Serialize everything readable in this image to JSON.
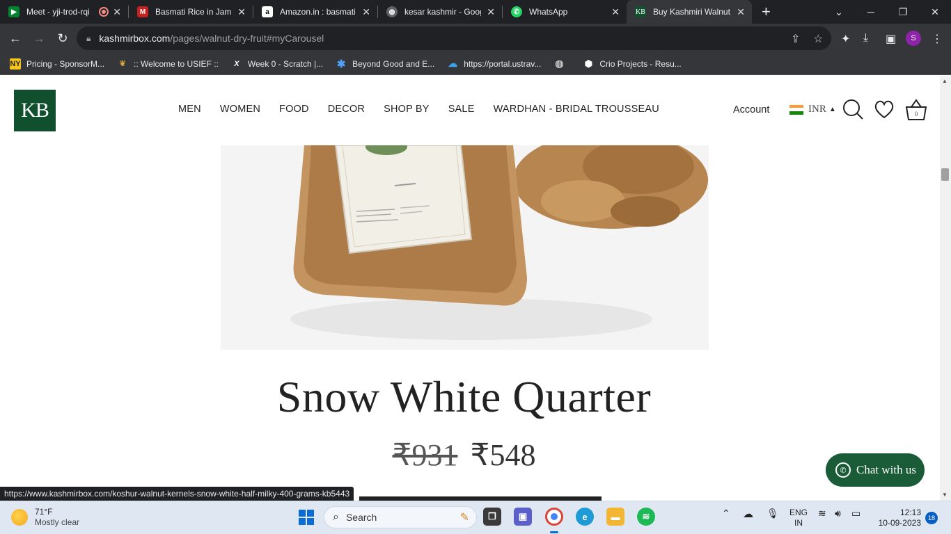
{
  "browser": {
    "tabs": [
      {
        "title": "Meet - yji-trod-rqi",
        "favicon": "google-meet-icon",
        "color": "#00832d",
        "recording": true
      },
      {
        "title": "Basmati Rice in Jammu",
        "favicon": "m-icon",
        "color": "#c5221f"
      },
      {
        "title": "Amazon.in : basmati ri",
        "favicon": "amazon-icon",
        "color": "#ffffff"
      },
      {
        "title": "kesar kashmir - Googl",
        "favicon": "globe-icon",
        "color": "#5f6368"
      },
      {
        "title": "WhatsApp",
        "favicon": "whatsapp-icon",
        "color": "#25d366"
      },
      {
        "title": "Buy Kashmiri Walnut O",
        "favicon": "kb-icon",
        "color": "#10502f",
        "active": true
      }
    ],
    "new_tab_label": "+",
    "url_host": "kashmirbox.com",
    "url_path": "/pages/walnut-dry-fruit#myCarousel",
    "profile_initial": "S",
    "bookmarks": [
      {
        "label": "Pricing - SponsorM...",
        "icon": "ny-icon"
      },
      {
        "label": ":: Welcome to USIEF ::",
        "icon": "usief-icon"
      },
      {
        "label": "Week 0 - Scratch |...",
        "icon": "x-icon"
      },
      {
        "label": "Beyond Good and E...",
        "icon": "asterisk-icon"
      },
      {
        "label": "https://portal.ustrav...",
        "icon": "cloud-icon"
      },
      {
        "label": "",
        "icon": "globe-icon"
      },
      {
        "label": "Crio Projects - Resu...",
        "icon": "crio-icon"
      }
    ]
  },
  "site": {
    "logo_text": "KB",
    "nav": [
      "MEN",
      "WOMEN",
      "FOOD",
      "DECOR",
      "SHOP BY",
      "SALE",
      "WARDHAN - BRIDAL TROUSSEAU"
    ],
    "account_label": "Account",
    "currency": "INR",
    "cart_count": "0",
    "product_title": "Snow White Quarter",
    "price_old": "₹931",
    "price_new": "₹548",
    "chat_label": "Chat with us",
    "status_url": "https://www.kashmirbox.com/koshur-walnut-kernels-snow-white-half-milky-400-grams-kb5443"
  },
  "taskbar": {
    "temperature": "71°F",
    "weather": "Mostly clear",
    "search_label": "Search",
    "lang_top": "ENG",
    "lang_bottom": "IN",
    "time": "12:13",
    "date": "10-09-2023",
    "notifications": "18"
  }
}
